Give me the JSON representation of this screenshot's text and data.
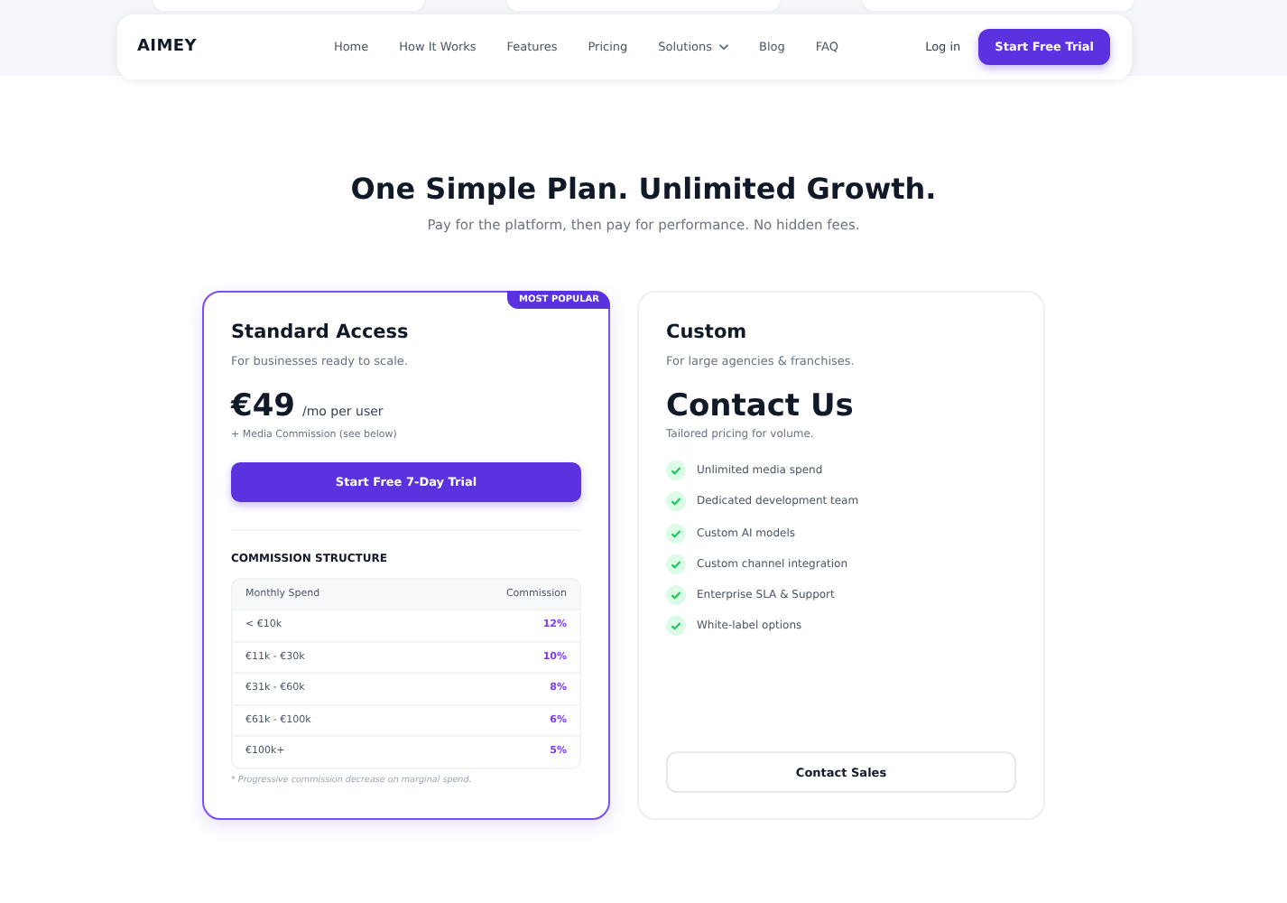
{
  "nav": {
    "logo": "AIMEY",
    "links": [
      {
        "label": "Home",
        "has_menu": false
      },
      {
        "label": "How It Works",
        "has_menu": false
      },
      {
        "label": "Features",
        "has_menu": false
      },
      {
        "label": "Pricing",
        "has_menu": false
      },
      {
        "label": "Solutions",
        "has_menu": true
      },
      {
        "label": "Blog",
        "has_menu": false
      },
      {
        "label": "FAQ",
        "has_menu": false
      }
    ],
    "login": "Log in",
    "cta": "Start Free Trial"
  },
  "heading": "One Simple Plan. Unlimited Growth.",
  "subheading": "Pay for the platform, then pay for performance. No hidden fees.",
  "standard": {
    "badge": "MOST POPULAR",
    "title": "Standard Access",
    "subtitle": "For businesses ready to scale.",
    "price": "€49",
    "price_unit": "/mo per user",
    "price_note": "+ Media Commission (see below)",
    "button": "Start Free 7-Day Trial",
    "commission_title": "COMMISSION STRUCTURE",
    "columns": [
      "Monthly Spend",
      "Commission"
    ],
    "rows": [
      {
        "spend": "< €10k",
        "rate": "12%"
      },
      {
        "spend": "€11k - €30k",
        "rate": "10%"
      },
      {
        "spend": "€31k - €60k",
        "rate": "8%"
      },
      {
        "spend": "€61k - €100k",
        "rate": "6%"
      },
      {
        "spend": "€100k+",
        "rate": "5%"
      }
    ],
    "footnote": "* Progressive commission decrease on marginal spend."
  },
  "custom": {
    "title": "Custom",
    "subtitle": "For large agencies & franchises.",
    "price": "Contact Us",
    "price_note": "Tailored pricing for volume.",
    "features": [
      "Unlimited media spend",
      "Dedicated development team",
      "Custom AI models",
      "Custom channel integration",
      "Enterprise SLA & Support",
      "White-label options"
    ],
    "button": "Contact Sales"
  }
}
